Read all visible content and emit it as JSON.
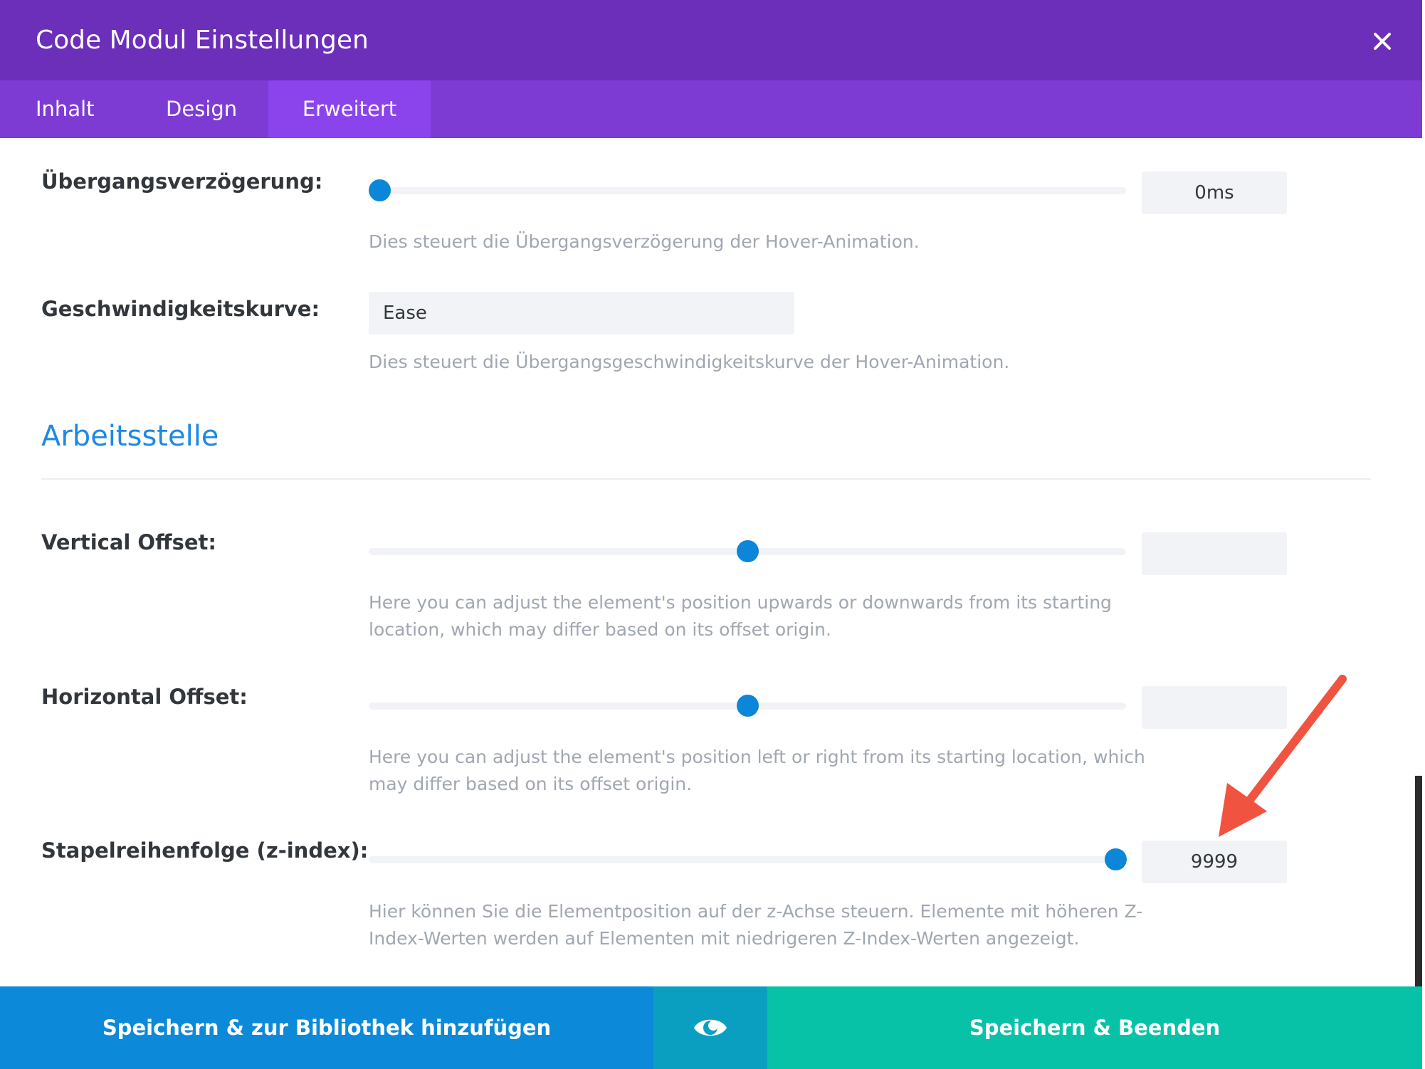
{
  "header": {
    "title": "Code Modul Einstellungen",
    "bg_color": "#6b2fba"
  },
  "tabs": [
    {
      "label": "Inhalt",
      "active": false
    },
    {
      "label": "Design",
      "active": false
    },
    {
      "label": "Erweitert",
      "active": true
    }
  ],
  "settings": {
    "transition_delay": {
      "label": "Übergangsverzögerung:",
      "value": "0ms",
      "slider_fraction": 0,
      "description": "Dies steuert die Übergangsverzögerung der Hover-Animation."
    },
    "speed_curve": {
      "label": "Geschwindigkeitskurve:",
      "value": "Ease",
      "description": "Dies steuert die Übergangsgeschwindigkeitskurve der Hover-Animation."
    },
    "section_title": "Arbeitsstelle",
    "vertical_offset": {
      "label": "Vertical Offset:",
      "value": "",
      "slider_fraction": 0.5,
      "description_lines": [
        "Here you can adjust the element's position upwards or downwards from its starting",
        "location, which may differ based on its offset origin."
      ]
    },
    "horizontal_offset": {
      "label": "Horizontal Offset:",
      "value": "",
      "slider_fraction": 0.5,
      "description_lines": [
        "Here you can adjust the element's position left or right from its starting location, which",
        "may differ based on its offset origin."
      ]
    },
    "z_index": {
      "label": "Stapelreihenfolge (z-index):",
      "value": "9999",
      "slider_fraction": 1,
      "description_lines": [
        "Hier können Sie die Elementposition auf der z-Achse steuern. Elemente mit höheren Z-",
        "Index-Werten werden auf Elementen mit niedrigeren Z-Index-Werten angezeigt."
      ]
    }
  },
  "footer": {
    "save_library_label": "Speichern & zur Bibliothek hinzufügen",
    "save_exit_label": "Speichern & Beenden"
  },
  "icons": {
    "close": "close-icon",
    "preview": "eye-icon"
  },
  "colors": {
    "accent_blue": "#0c86d8",
    "save_green": "#08c2a8",
    "annotation_red": "#f05340"
  }
}
